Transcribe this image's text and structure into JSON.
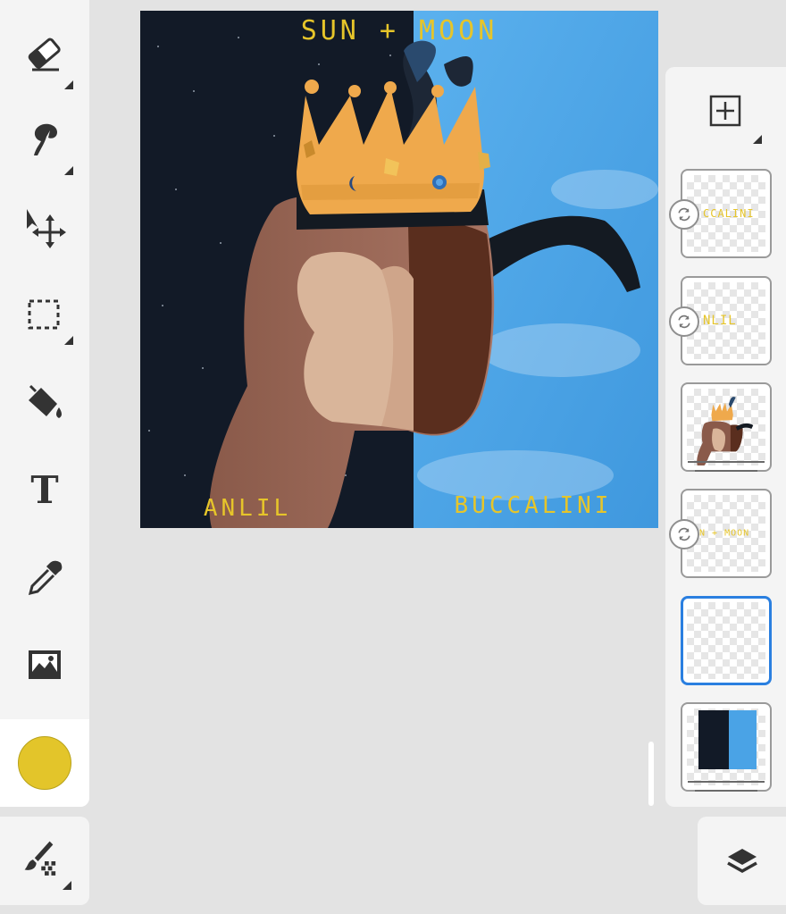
{
  "toolbar": {
    "tools": [
      {
        "name": "eraser",
        "icon": "eraser-icon"
      },
      {
        "name": "smudge",
        "icon": "smudge-icon"
      },
      {
        "name": "move",
        "icon": "move-icon"
      },
      {
        "name": "selection",
        "icon": "selection-icon"
      },
      {
        "name": "fill",
        "icon": "paint-bucket-icon"
      },
      {
        "name": "text",
        "icon": "text-icon"
      },
      {
        "name": "eyedropper",
        "icon": "eyedropper-icon"
      },
      {
        "name": "image",
        "icon": "image-icon"
      }
    ],
    "text_tool_glyph": "T",
    "current_color": "#e3c52a",
    "brush_icon": "brush-grid-icon"
  },
  "canvas": {
    "title_text": "SUN + MOON",
    "left_name": "ANLIL",
    "right_name": "BUCCALINI",
    "colors": {
      "night": "#121a27",
      "sky": "#4aa3e6",
      "crown": "#f0a84a",
      "text": "#e6c52a"
    }
  },
  "layers": {
    "add_icon": "add-layer-icon",
    "items": [
      {
        "label": "CCALINI",
        "clipped": true,
        "selected": false
      },
      {
        "label": "NLIL",
        "clipped": true,
        "selected": false
      },
      {
        "label": "",
        "clipped": false,
        "selected": false
      },
      {
        "label": "N + MOON",
        "clipped": true,
        "selected": false
      },
      {
        "label": "",
        "clipped": false,
        "selected": true
      },
      {
        "label": "",
        "clipped": false,
        "selected": false
      }
    ],
    "layers_button_icon": "layers-icon",
    "accent": "#2a7fe0"
  }
}
